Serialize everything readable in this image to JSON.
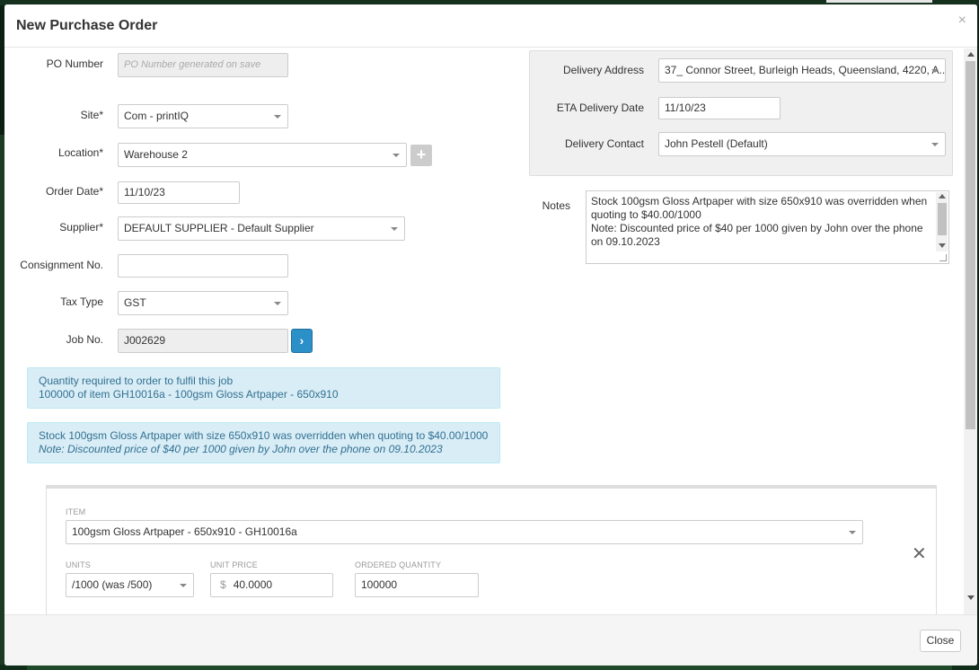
{
  "modal": {
    "title": "New Purchase Order",
    "close_icon": "×"
  },
  "form": {
    "po_number": {
      "label": "PO Number",
      "placeholder": "PO Number generated on save"
    },
    "site": {
      "label": "Site*",
      "value": "Com - printIQ"
    },
    "location": {
      "label": "Location*",
      "value": "Warehouse 2",
      "add_icon": "+"
    },
    "order_date": {
      "label": "Order Date*",
      "value": "11/10/23"
    },
    "supplier": {
      "label": "Supplier*",
      "value": "DEFAULT SUPPLIER - Default Supplier"
    },
    "consignment": {
      "label": "Consignment No.",
      "value": ""
    },
    "tax_type": {
      "label": "Tax Type",
      "value": "GST"
    },
    "job_no": {
      "label": "Job No.",
      "value": "J002629",
      "go_icon": "›"
    }
  },
  "delivery": {
    "address": {
      "label": "Delivery Address",
      "value": "37_ Connor Street, Burleigh Heads, Queensland, 4220, A..."
    },
    "eta": {
      "label": "ETA Delivery Date",
      "value": "11/10/23"
    },
    "contact": {
      "label": "Delivery Contact",
      "value": "John Pestell (Default)"
    }
  },
  "notes": {
    "label": "Notes",
    "line1": "Stock 100gsm Gloss Artpaper with size 650x910 was overridden when quoting to $40.00/1000",
    "line2": "Note: Discounted price of $40 per 1000 given by John over the phone on 09.10.2023"
  },
  "info_boxes": {
    "qty": {
      "line1": "Quantity required to order to fulfil this job",
      "line2": "100000 of item GH10016a - 100gsm Gloss Artpaper - 650x910"
    },
    "stock": {
      "line1": "Stock 100gsm Gloss Artpaper with size 650x910 was overridden when quoting to $40.00/1000",
      "line2": "Note: Discounted price of $40 per 1000 given by John over the phone on 09.10.2023"
    }
  },
  "item_line": {
    "item_label": "ITEM",
    "item_value": "100gsm Gloss Artpaper - 650x910 - GH10016a",
    "units_label": "UNITS",
    "units_value": "/1000 (was /500)",
    "unit_price_label": "UNIT PRICE",
    "currency": "$",
    "unit_price_value": "40.0000",
    "ordered_qty_label": "ORDERED QUANTITY",
    "ordered_qty_value": "100000",
    "remove_icon": "✕"
  },
  "footer": {
    "close_label": "Close"
  }
}
